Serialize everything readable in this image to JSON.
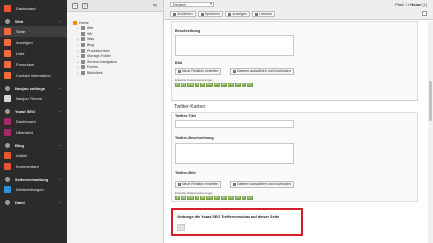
{
  "module_menu": {
    "items": [
      {
        "label": "Dashboard",
        "color": "#e8562b",
        "type": "item"
      },
      {
        "label": "Web",
        "type": "group"
      },
      {
        "label": "Seite",
        "color": "#f16c3a",
        "type": "item",
        "active": true
      },
      {
        "label": "Anzeigen",
        "color": "#f16c3a",
        "type": "item"
      },
      {
        "label": "Liste",
        "color": "#f16c3a",
        "type": "item"
      },
      {
        "label": "Formulare",
        "color": "#f16c3a",
        "type": "item"
      },
      {
        "label": "Contact information",
        "color": "#f16c3a",
        "type": "item"
      },
      {
        "label": "Neujou settings",
        "type": "group"
      },
      {
        "label": "Neujou Theme",
        "color": "#d6d6d6",
        "type": "item"
      },
      {
        "label": "Yoast SEO",
        "type": "group"
      },
      {
        "label": "Dashboard",
        "color": "#a4286a",
        "type": "item"
      },
      {
        "label": "Übersicht",
        "color": "#a4286a",
        "type": "item"
      },
      {
        "label": "Blog",
        "type": "group"
      },
      {
        "label": "Artikel",
        "color": "#e8562b",
        "type": "item"
      },
      {
        "label": "Kommentare",
        "color": "#e8562b",
        "type": "item"
      },
      {
        "label": "Seitenverwaltung",
        "type": "group"
      },
      {
        "label": "Weiterleitungen",
        "color": "#2f8fd9",
        "type": "item"
      },
      {
        "label": "Datei",
        "type": "group"
      }
    ]
  },
  "page_tree": {
    "nodes": [
      {
        "label": "Home",
        "level": 0,
        "root": true
      },
      {
        "label": "Wer",
        "level": 1,
        "expand": "+"
      },
      {
        "label": "Wir",
        "level": 1,
        "expand": ""
      },
      {
        "label": "Was",
        "level": 1,
        "expand": "+"
      },
      {
        "label": "Blog",
        "level": 1,
        "expand": "+"
      },
      {
        "label": "Produktordner",
        "level": 1,
        "expand": "+"
      },
      {
        "label": "Storage-Folder",
        "level": 1,
        "expand": "+"
      },
      {
        "label": "Service-Navigation",
        "level": 1,
        "expand": "+"
      },
      {
        "label": "Events",
        "level": 1,
        "expand": "+"
      },
      {
        "label": "Bibliothek",
        "level": 1,
        "expand": "+"
      }
    ]
  },
  "doc_header": {
    "language": "Deutsch",
    "path_prefix": "Pfad: /",
    "page_title": "Home",
    "page_index": "[1]",
    "buttons": {
      "close": "Schließen",
      "save": "Speichern",
      "view": "Anzeigen",
      "delete": "Löschen"
    }
  },
  "form": {
    "og_description_label": "Beschreibung",
    "og_image_label": "Bild",
    "new_relation_label": "Neue Relation erstellen",
    "select_upload_label": "Dateien auswählen und hochladen",
    "allowed_types_label": "Erlaubte Dateierweiterungen",
    "extensions": [
      "gif",
      "jpg",
      "jpeg",
      "tif",
      "tiff",
      "bmp",
      "pcx",
      "tga",
      "png",
      "pdf",
      "ai",
      "svg"
    ],
    "twitter_section_title": "Twitter-Karten",
    "twitter_title_label": "Twitter-Titel",
    "twitter_description_label": "Twitter-Beschreibung",
    "twitter_image_label": "Twitter-Bild",
    "preview_label": "Vorborge die Yoast SEO Trefferorvschau auf dieser Seite"
  }
}
